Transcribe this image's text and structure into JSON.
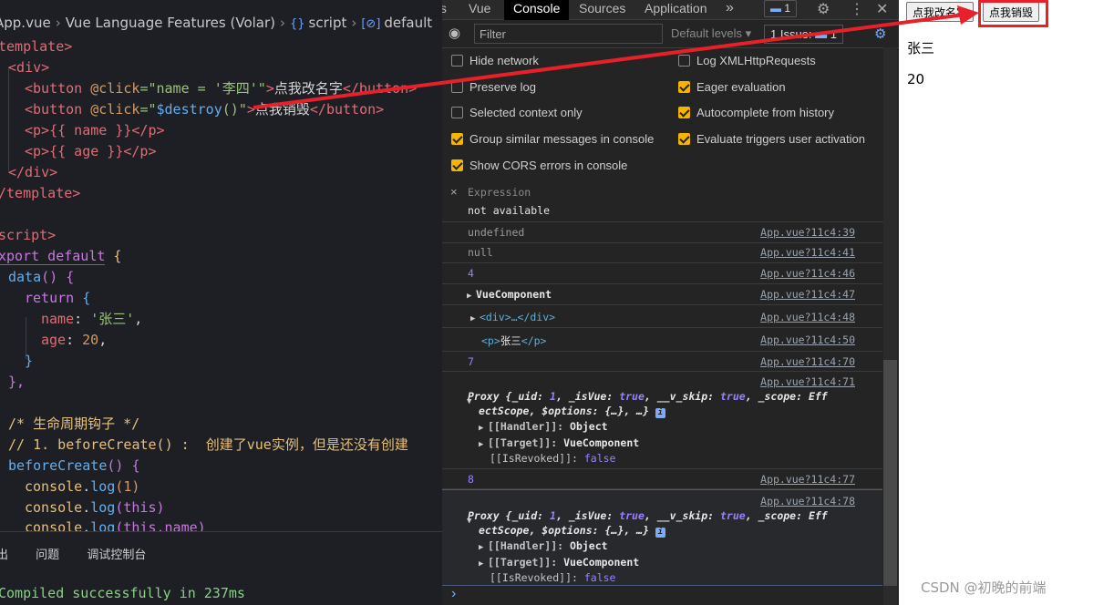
{
  "editor": {
    "breadcrumb": {
      "file": "App.vue",
      "section": "Vue Language Features (Volar)",
      "script": "script",
      "symbol": "default",
      "braces_icon": "{}",
      "symbol_icon": "[⊘]"
    },
    "lines": {
      "l1": "template>",
      "l2_indent": " ",
      "l2": "<div>",
      "l3_open": "<button",
      "l3_attr": "@click",
      "l3_eq": "=\"",
      "l3_val": "name = '李四'",
      "l3_q": "\"",
      "l3_gt": ">",
      "l3_text": "点我改名字",
      "l3_close": "</button>",
      "l4_open": "<button",
      "l4_attr": "@click",
      "l4_eq": "=\"",
      "l4_fn": "$destroy",
      "l4_paren": "()",
      "l4_q": "\"",
      "l4_gt": ">",
      "l4_text": "点我销毁",
      "l4_close": "</button>",
      "l5": "<p>{{ name }}</p>",
      "l6": "<p>{{ age }}</p>",
      "l7": "</div>",
      "l8": "/template>",
      "l10": "script>",
      "l11_kw": "xport default",
      "l11_brace": " {",
      "l12_fn": "data",
      "l12_rest": "() {",
      "l13_kw": "return",
      "l13_rest": " {",
      "l14_key": "name",
      "l14_colon": ": ",
      "l14_val": "'张三'",
      "l14_comma": ",",
      "l15_key": "age",
      "l15_colon": ": ",
      "l15_val": "20",
      "l15_comma": ",",
      "l16": "}",
      "l17": "},",
      "l19": "/* 生命周期钩子 */",
      "l20": "// 1. beforeCreate() :  创建了vue实例，但是还没有创建",
      "l21_fn": "beforeCreate",
      "l21_rest": "() {",
      "l22_obj": "console",
      "l22_dot": ".",
      "l22_fn": "log",
      "l22_arg": "(1)",
      "l23_obj": "console",
      "l23_dot": ".",
      "l23_fn": "log",
      "l23_arg": "(this)",
      "l24_obj": "console",
      "l24_dot": ".",
      "l24_fn": "log",
      "l24_arg": "(this.name)"
    },
    "panel": {
      "tabs": [
        "出",
        "问题",
        "调试控制台"
      ],
      "compile_message": "Compiled successfully in 237ms"
    }
  },
  "devtools": {
    "tabs": {
      "prev": "ts",
      "vue": "Vue",
      "console": "Console",
      "sources": "Sources",
      "application": "Application",
      "more": "»"
    },
    "message_badge": "1",
    "toolbar": {
      "filter_placeholder": "Filter",
      "levels": "Default levels ▾",
      "issues_label": "1 Issue:",
      "issues_count": "1"
    },
    "settings": [
      {
        "label": "Hide network",
        "checked": false
      },
      {
        "label": "Log XMLHttpRequests",
        "checked": false
      },
      {
        "label": "Preserve log",
        "checked": false
      },
      {
        "label": "Eager evaluation",
        "checked": true
      },
      {
        "label": "Selected context only",
        "checked": false
      },
      {
        "label": "Autocomplete from history",
        "checked": true
      },
      {
        "label": "Group similar messages in console",
        "checked": true
      },
      {
        "label": "Evaluate triggers user activation",
        "checked": true
      },
      {
        "label": "Show CORS errors in console",
        "checked": true
      }
    ],
    "expression": {
      "close": "×",
      "title": "Expression",
      "value": "not available"
    },
    "console": {
      "r1": {
        "text": "undefined",
        "link": "App.vue?11c4:39"
      },
      "r2": {
        "text": "null",
        "link": "App.vue?11c4:41"
      },
      "r3": {
        "text": "4",
        "link": "App.vue?11c4:46"
      },
      "r4": {
        "text": "VueComponent",
        "link": "App.vue?11c4:47"
      },
      "r5": {
        "text": "<div>…</div>",
        "link": "App.vue?11c4:48"
      },
      "r6": {
        "open": "<p>",
        "text": "张三",
        "close": "</p>",
        "link": "App.vue?11c4:50"
      },
      "r7": {
        "text": "7",
        "link": "App.vue?11c4:70"
      },
      "r8": {
        "link": "App.vue?11c4:71"
      },
      "r9": {
        "text": "8",
        "link": "App.vue?11c4:77"
      },
      "r10": {
        "link": "App.vue?11c4:78"
      },
      "proxy": {
        "head1": "Proxy {_uid: ",
        "uid": "1",
        "head2": ", _isVue: ",
        "isvue": "true",
        "head3": ", __v_skip: ",
        "vskip": "true",
        "head4": ", _scope: Eff",
        "line2": "ectScope, $options: {…}, …}",
        "handler_key": "[[Handler]]: ",
        "handler_val": "Object",
        "target_key": "[[Target]]: ",
        "target_val": "VueComponent",
        "revoked_key": "[[IsRevoked]]: ",
        "revoked_val": "false"
      },
      "prompt": "›"
    }
  },
  "page": {
    "rename_button": "点我改名字",
    "destroy_button": "点我销毁",
    "name": "张三",
    "age": "20",
    "watermark": "CSDN @初晚的前端"
  },
  "colors": {
    "highlight": "#e8202a",
    "console_tab_bg": "#000000",
    "checkbox_on": "#f4b400"
  }
}
